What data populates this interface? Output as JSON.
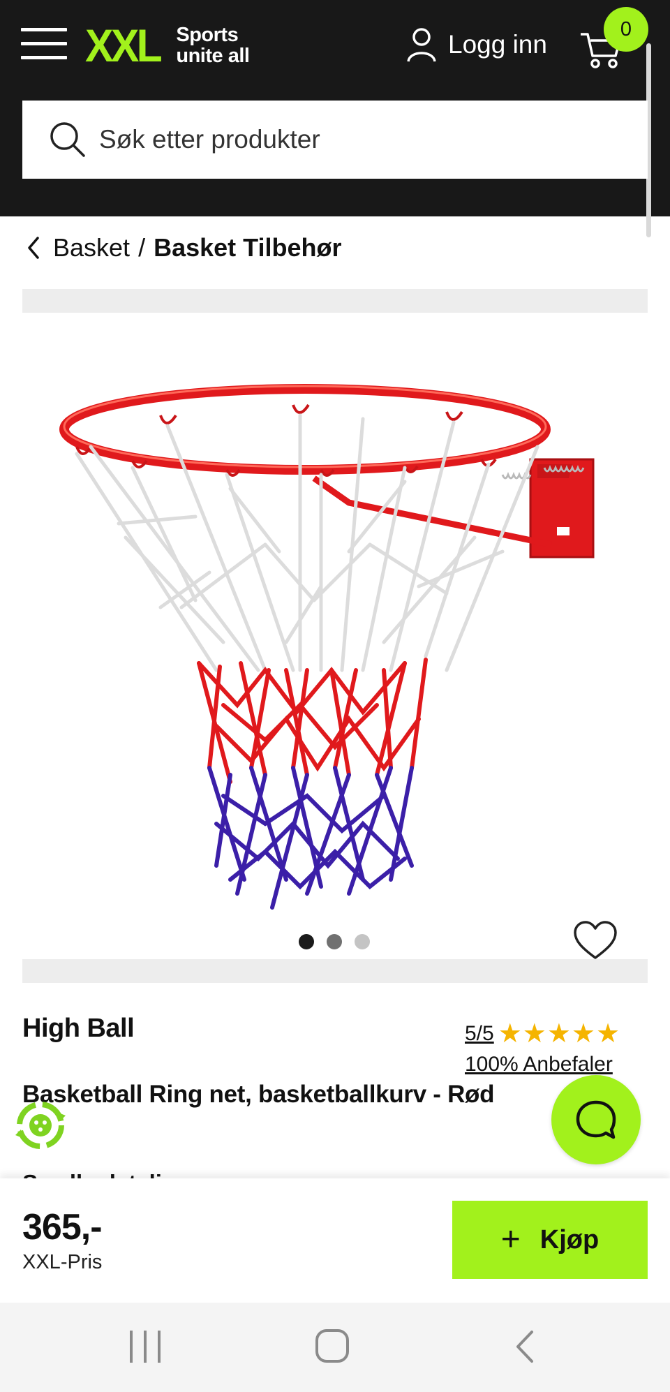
{
  "header": {
    "logo_mark": "XXL",
    "logo_tagline_1": "Sports",
    "logo_tagline_2": "unite all",
    "login_label": "Logg inn",
    "cart_count": "0"
  },
  "search": {
    "placeholder": "Søk etter produkter"
  },
  "breadcrumb": {
    "parent": "Basket",
    "separator": "/",
    "current": "Basket Tilbehør"
  },
  "gallery": {
    "image_alt": "Basketball ring with red, white and blue net",
    "dots": 3,
    "active_dot": 0
  },
  "product": {
    "brand": "High Ball",
    "rating": "5/5",
    "stars": "★★★★★",
    "rating_value": 5,
    "recommend": "100% Anbefaler",
    "title": "Basketball Ring net, basketballkurv - Rød",
    "details_link": "Se alle detaljer"
  },
  "buybar": {
    "price": "365,-",
    "price_label": "XXL-Pris",
    "buy_label": "Kjøp"
  },
  "colors": {
    "brand_green": "#a2f11c",
    "header_bg": "#181818",
    "star": "#f5b400",
    "hoop_red": "#e0191c",
    "net_blue": "#3b1fa8"
  }
}
